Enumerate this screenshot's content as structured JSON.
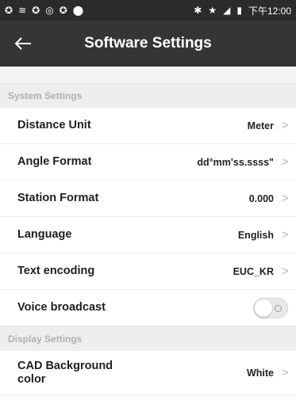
{
  "status_bar": {
    "icons": [
      "sync-icon",
      "wifi-icon",
      "sync-icon",
      "alarm-icon",
      "sync-icon",
      "location-icon",
      "bluetooth-icon",
      "star-icon",
      "signal-icon",
      "battery-icon"
    ],
    "time": "下午12:00"
  },
  "app_bar": {
    "title": "Software Settings",
    "back_icon": "arrow-left-icon"
  },
  "sections": {
    "system": {
      "header": "System Settings",
      "rows": {
        "distance_unit": {
          "label": "Distance Unit",
          "value": "Meter"
        },
        "angle_format": {
          "label": "Angle Format",
          "value": "dd°mm'ss.ssss\""
        },
        "station_format": {
          "label": "Station Format",
          "value": "0.000"
        },
        "language": {
          "label": "Language",
          "value": "English"
        },
        "text_encoding": {
          "label": "Text encoding",
          "value": "EUC_KR"
        },
        "voice_broadcast": {
          "label": "Voice broadcast",
          "enabled": false
        }
      }
    },
    "display": {
      "header": "Display Settings",
      "rows": {
        "cad_background": {
          "label_line1": "CAD Background",
          "label_line2": "color",
          "value": "White"
        }
      }
    }
  },
  "colors": {
    "status_bar_bg": "#2b2b2b",
    "app_bar_bg": "#353535",
    "section_header_bg": "#eeeeee",
    "section_header_text": "#b0b0b0"
  }
}
